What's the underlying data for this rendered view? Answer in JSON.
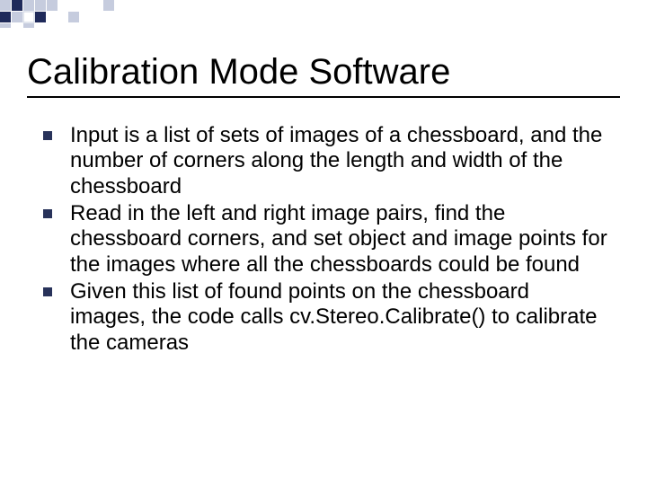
{
  "title": "Calibration Mode Software",
  "bullets": [
    "Input is a list of sets of images of a chessboard, and the number of corners along the length and width of the chessboard",
    "Read in the left and right image pairs, find the chessboard corners, and set object and image points for the images where all the chessboards could be found",
    "Given this list of found points on the chessboard images, the code calls cv.Stereo.Calibrate() to calibrate the cameras"
  ],
  "deco": {
    "dark": "#1f2a5a",
    "light": "#c6ccde",
    "white": "#ffffff"
  }
}
